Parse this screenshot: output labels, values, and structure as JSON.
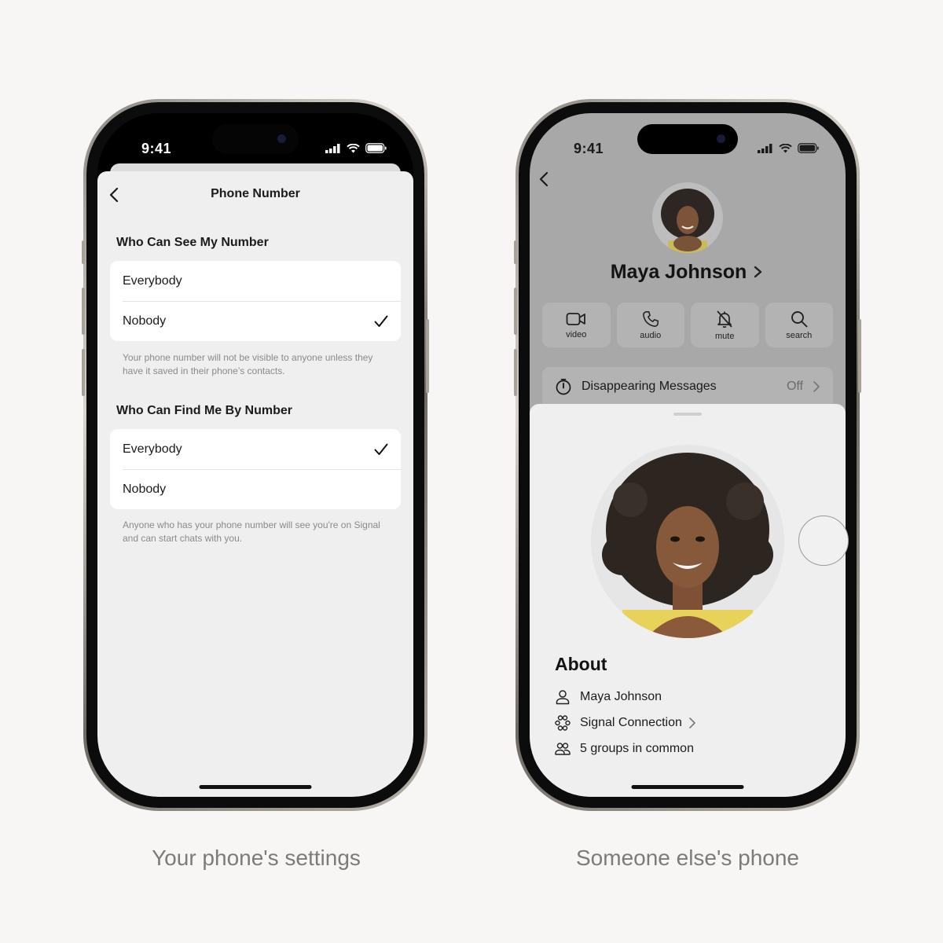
{
  "captions": {
    "left": "Your phone's settings",
    "right": "Someone else's phone"
  },
  "left_phone": {
    "status": {
      "time": "9:41"
    },
    "nav": {
      "title": "Phone Number",
      "back_icon": "chevron-left-icon"
    },
    "sections": [
      {
        "title": "Who Can See My Number",
        "options": [
          {
            "label": "Everybody",
            "selected": false
          },
          {
            "label": "Nobody",
            "selected": true
          }
        ],
        "footnote": "Your phone number will not be visible to anyone unless they have it saved in their phone’s contacts."
      },
      {
        "title": "Who Can Find Me By Number",
        "options": [
          {
            "label": "Everybody",
            "selected": true
          },
          {
            "label": "Nobody",
            "selected": false
          }
        ],
        "footnote": "Anyone who has your phone number will see you're on Signal and can start chats with you."
      }
    ]
  },
  "right_phone": {
    "status": {
      "time": "9:41"
    },
    "contact": {
      "name": "Maya Johnson"
    },
    "actions": [
      {
        "label": "video",
        "icon": "video-icon"
      },
      {
        "label": "audio",
        "icon": "phone-icon"
      },
      {
        "label": "mute",
        "icon": "bell-slash-icon"
      },
      {
        "label": "search",
        "icon": "search-icon"
      }
    ],
    "disappearing": {
      "label": "Disappearing Messages",
      "value": "Off"
    },
    "about": {
      "title": "About",
      "items": [
        {
          "label": "Maya Johnson",
          "icon": "person-icon"
        },
        {
          "label": "Signal Connection",
          "icon": "signal-connection-icon",
          "chevron": true
        },
        {
          "label": "5 groups in common",
          "icon": "group-icon"
        }
      ]
    }
  },
  "colors": {
    "page_bg": "#f8f6f4",
    "sheet_bg": "#efefef",
    "dimmed_bg": "#a8a8a8",
    "caption": "#7b7b7b"
  }
}
